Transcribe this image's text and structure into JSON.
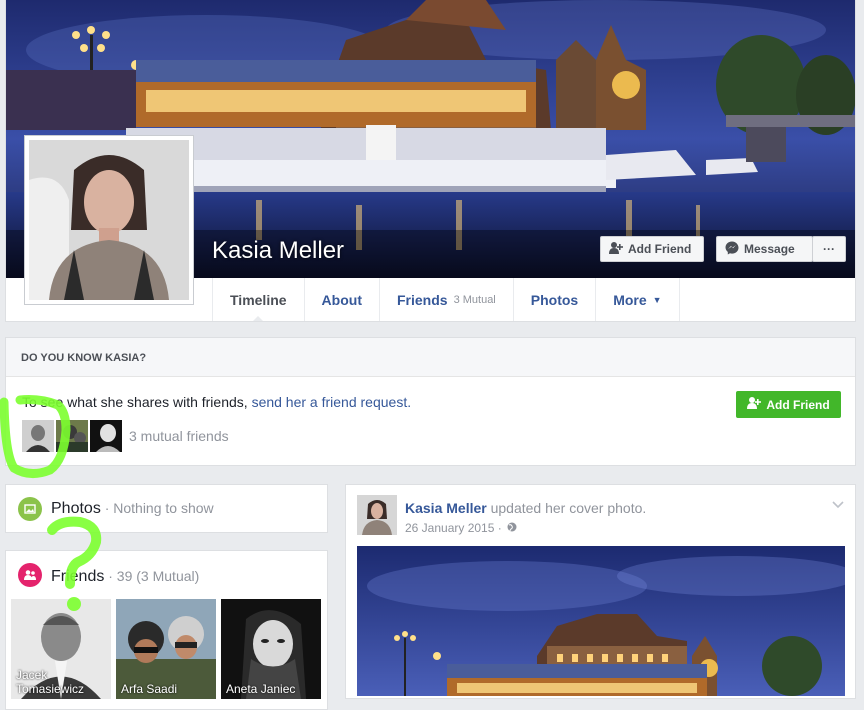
{
  "profile": {
    "name": "Kasia Meller"
  },
  "header_buttons": {
    "add_friend": "Add Friend",
    "message": "Message",
    "more": "···"
  },
  "tabs": [
    {
      "label": "Timeline",
      "active": true
    },
    {
      "label": "About"
    },
    {
      "label": "Friends",
      "sub": "3 Mutual"
    },
    {
      "label": "Photos"
    },
    {
      "label": "More",
      "caret": "▼"
    }
  ],
  "know": {
    "title": "DO YOU KNOW KASIA?",
    "text": "To see what she shares with friends, ",
    "link": "send her a friend request.",
    "button": "Add Friend",
    "mutual": "3 mutual friends"
  },
  "photos_card": {
    "title": "Photos",
    "sub": " · Nothing to show"
  },
  "friends_card": {
    "title": "Friends",
    "sub": " · 39 (3 Mutual)",
    "friends": [
      {
        "name": "Jacek Tomasiewicz"
      },
      {
        "name": "Arfa Saadi"
      },
      {
        "name": "Aneta Janiec"
      }
    ]
  },
  "post": {
    "author": "Kasia Meller",
    "action": " updated her cover photo.",
    "date": "26 January 2015 · "
  },
  "colors": {
    "link": "#365899",
    "green": "#42b72a",
    "background": "#e9ebee",
    "scribble": "#7cff2f"
  }
}
